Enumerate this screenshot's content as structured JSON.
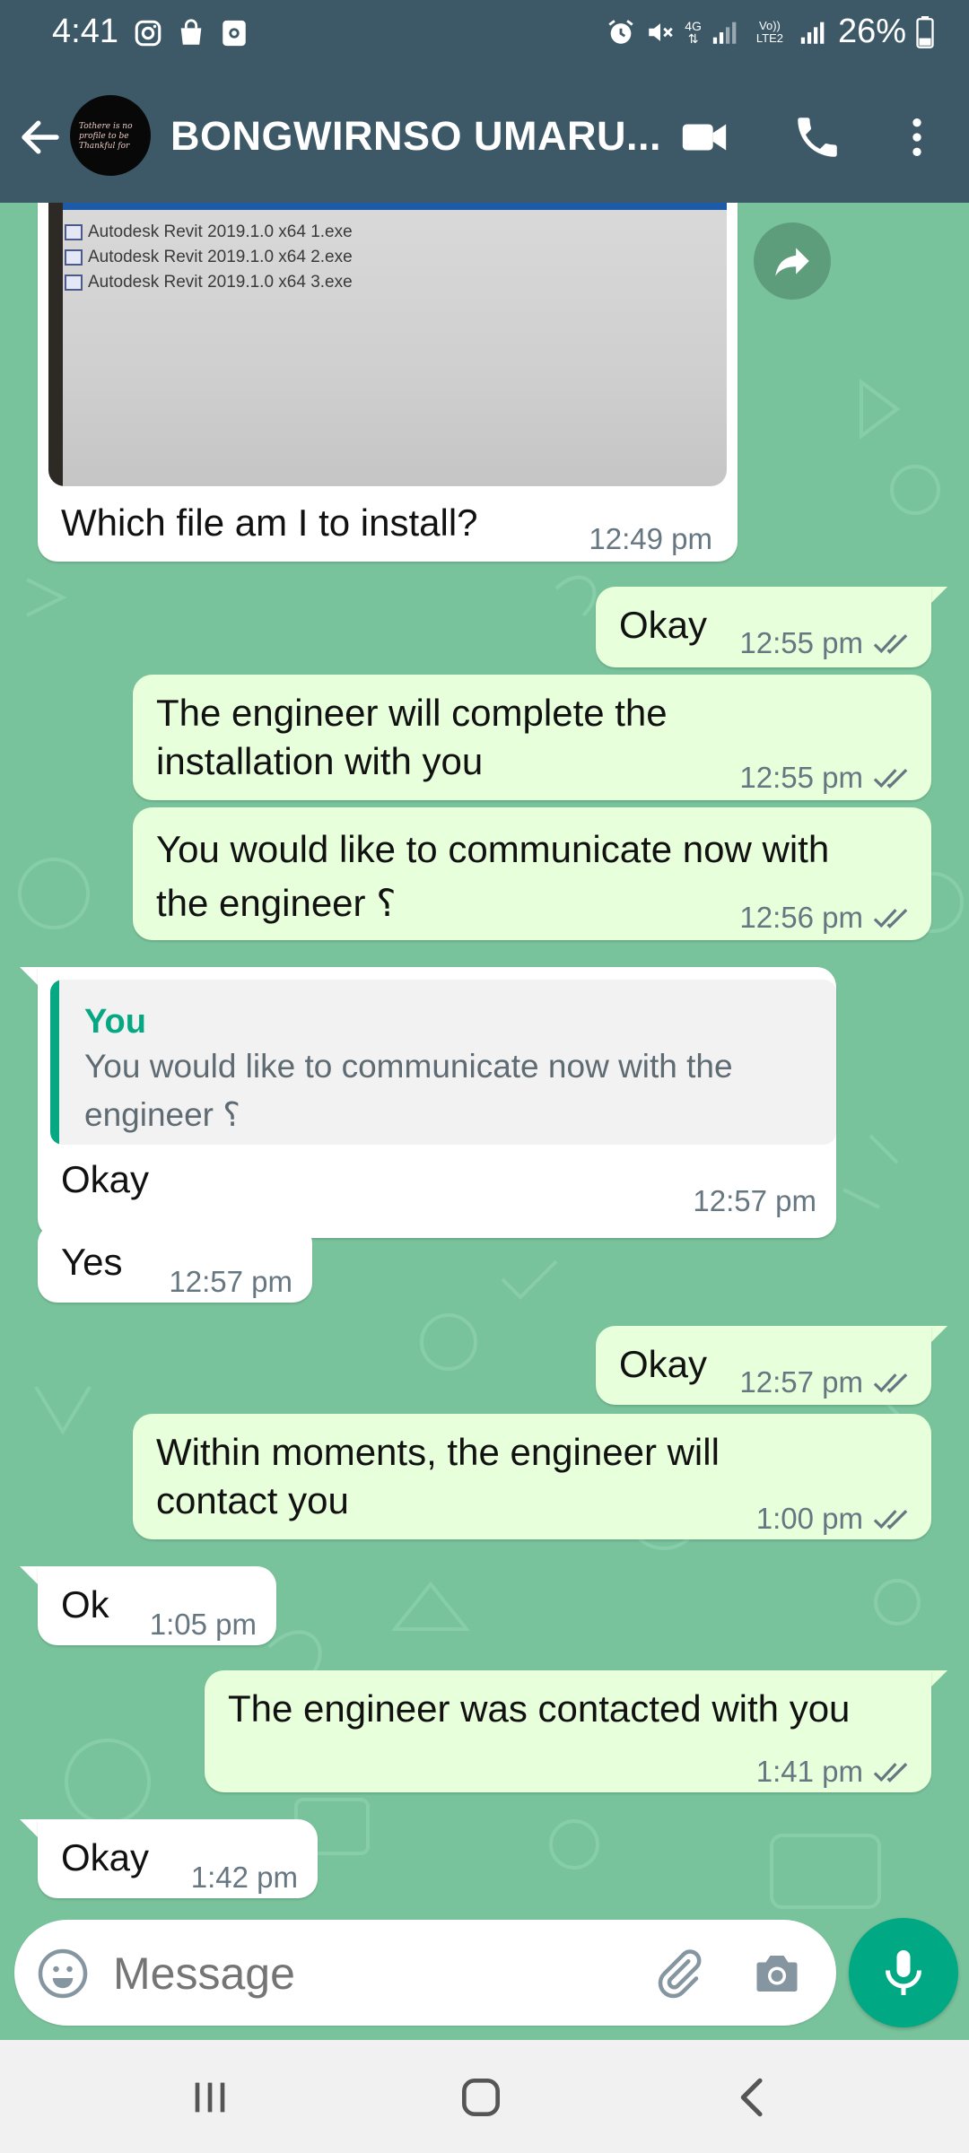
{
  "status_bar": {
    "time": "4:41",
    "network_4g": "4G",
    "volte": "Vo)) LTE2",
    "battery_percent": "26%",
    "icons": [
      "instagram-icon",
      "shopping-bag-icon",
      "screen-record-icon",
      "alarm-icon",
      "mute-icon",
      "network-4g-icon",
      "signal-icon",
      "volte-icon",
      "signal-icon",
      "battery-icon"
    ]
  },
  "app_bar": {
    "contact_name": "BONGWIRNSO UMARU...",
    "avatar_text": "Tothere is no profile to be Thankful for",
    "icons": [
      "back-arrow-icon",
      "video-call-icon",
      "voice-call-icon",
      "more-options-icon"
    ]
  },
  "colors": {
    "header": "#3d5866",
    "wallpaper": "#79c39c",
    "incoming_bubble": "#ffffff",
    "outgoing_bubble": "#e7ffdb",
    "accent": "#00a884",
    "read_ticks": "#667781"
  },
  "image_message": {
    "files": [
      "Autodesk Revit 2019.1.0 x64 1.exe",
      "Autodesk Revit 2019.1.0 x64 2.exe",
      "Autodesk Revit 2019.1.0 x64 3.exe"
    ],
    "caption": "Which file am I to install?",
    "time": "12:49 pm"
  },
  "messages": [
    {
      "dir": "out",
      "text": "Okay",
      "time": "12:55 pm"
    },
    {
      "dir": "out",
      "text_lines": [
        "The engineer will complete the",
        "installation with you"
      ],
      "time": "12:55 pm"
    },
    {
      "dir": "out",
      "text_lines": [
        "You would like to communicate now with",
        "the engineer ؟"
      ],
      "time": "12:56 pm"
    },
    {
      "dir": "in",
      "quote_author": "You",
      "quote_lines": [
        "You would like to communicate now with the",
        "engineer ؟"
      ],
      "text": "Okay",
      "time": "12:57 pm"
    },
    {
      "dir": "in",
      "text": "Yes",
      "time": "12:57 pm"
    },
    {
      "dir": "out",
      "text": "Okay",
      "time": "12:57 pm"
    },
    {
      "dir": "out",
      "text_lines": [
        "Within moments, the engineer will",
        "contact you"
      ],
      "time": "1:00 pm"
    },
    {
      "dir": "in",
      "text": "Ok",
      "time": "1:05 pm"
    },
    {
      "dir": "out",
      "text": "The engineer was contacted with you",
      "time": "1:41 pm"
    },
    {
      "dir": "in",
      "text": "Okay",
      "time": "1:42 pm"
    }
  ],
  "composer": {
    "placeholder": "Message",
    "icons": [
      "emoji-icon",
      "attach-icon",
      "camera-icon",
      "mic-icon"
    ]
  },
  "nav_bar": {
    "icons": [
      "recent-apps-icon",
      "home-icon",
      "back-icon"
    ]
  }
}
